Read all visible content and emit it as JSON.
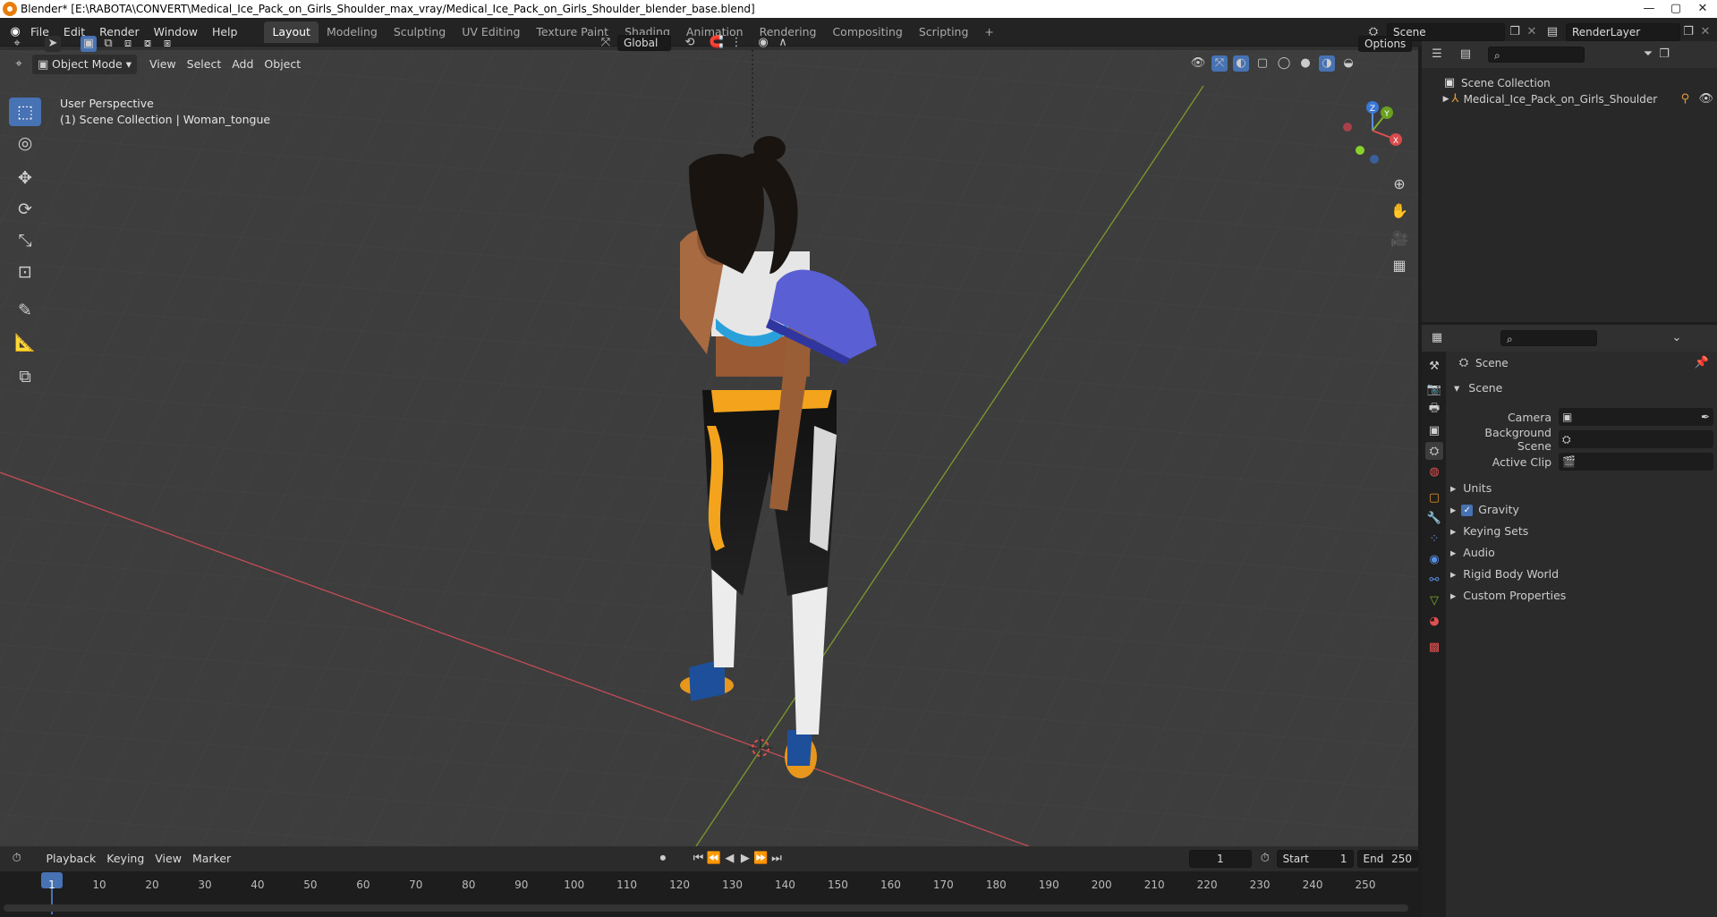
{
  "titlebar": {
    "title": "Blender* [E:\\RABOTA\\CONVERT\\Medical_Ice_Pack_on_Girls_Shoulder_max_vray/Medical_Ice_Pack_on_Girls_Shoulder_blender_base.blend]",
    "minimize": "—",
    "maximize": "▢",
    "close": "✕"
  },
  "menubar": {
    "items": [
      "File",
      "Edit",
      "Render",
      "Window",
      "Help"
    ]
  },
  "workspaces": {
    "tabs": [
      "Layout",
      "Modeling",
      "Sculpting",
      "UV Editing",
      "Texture Paint",
      "Shading",
      "Animation",
      "Rendering",
      "Compositing",
      "Scripting"
    ],
    "active": "Layout",
    "add": "+"
  },
  "scene_selector": {
    "value": "Scene"
  },
  "renderlayer_selector": {
    "value": "RenderLayer"
  },
  "viewport": {
    "mode": "Object Mode",
    "menus": [
      "View",
      "Select",
      "Add",
      "Object"
    ],
    "transform_orientation": "Global",
    "options_label": "Options",
    "perspective_label": "User Perspective",
    "collection_label": "(1) Scene Collection | Woman_tongue",
    "gizmo": {
      "z": "Z",
      "y": "Y",
      "x": "X"
    },
    "colors": {
      "bg": "#3d3d3d",
      "x_axis": "#c44c55",
      "y_axis": "#7a9b2a"
    }
  },
  "outliner": {
    "root": "Scene Collection",
    "items": [
      {
        "label": "Medical_Ice_Pack_on_Girls_Shoulder"
      }
    ]
  },
  "properties": {
    "context_title": "Scene",
    "panel_title": "Scene",
    "rows": [
      {
        "label": "Camera",
        "value": ""
      },
      {
        "label": "Background Scene",
        "value": ""
      },
      {
        "label": "Active Clip",
        "value": ""
      }
    ],
    "sections": [
      "Units",
      "Gravity",
      "Keying Sets",
      "Audio",
      "Rigid Body World",
      "Custom Properties"
    ],
    "gravity_checked": "✓"
  },
  "timeline": {
    "menus": [
      "Playback",
      "Keying",
      "View",
      "Marker"
    ],
    "current_frame": "1",
    "start_label": "Start",
    "start_value": "1",
    "end_label": "End",
    "end_value": "250",
    "ticks": [
      "1",
      "10",
      "20",
      "30",
      "40",
      "50",
      "60",
      "70",
      "80",
      "90",
      "100",
      "110",
      "120",
      "130",
      "140",
      "150",
      "160",
      "170",
      "180",
      "190",
      "200",
      "210",
      "220",
      "230",
      "240",
      "250"
    ]
  }
}
